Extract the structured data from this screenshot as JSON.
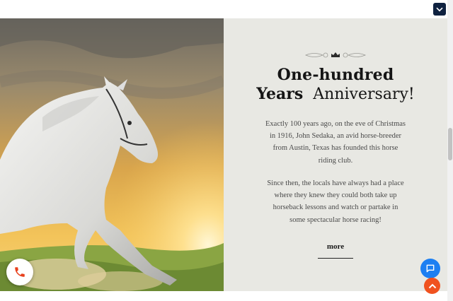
{
  "header": {
    "menu_icon": "chevron-down-icon"
  },
  "section": {
    "title_line1": "One-hundred",
    "title_line2_bold": "Years",
    "title_line2_rest": "Anniversary!",
    "paragraph1": "Exactly 100 years ago, on the eve of Christmas in 1916, John Sedaka, an avid horse-breeder from Austin, Texas has founded this horse riding club.",
    "paragraph2": "Since then, the locals have always had a place where they knew they could both take up horseback lessons and watch or partake in some spectacular horse racing!",
    "more_label": "more"
  },
  "floating": {
    "phone_icon": "phone-icon",
    "chat_icon": "chat-icon",
    "scroll_top_icon": "chevron-up-icon"
  },
  "colors": {
    "panel_bg": "#e8e8e3",
    "menu_button": "#0f2240",
    "chat_button": "#1d7ff2",
    "scroll_top_button": "#f0521f",
    "phone_icon": "#e8401c"
  }
}
